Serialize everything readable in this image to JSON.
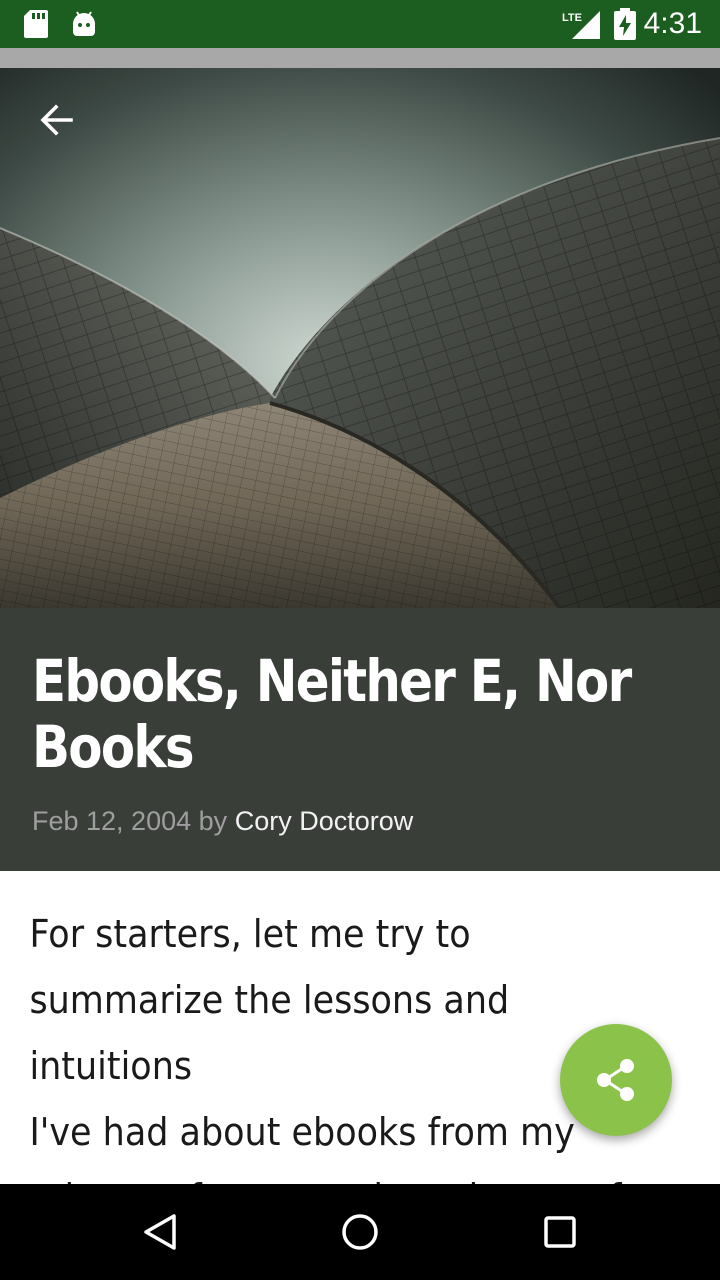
{
  "status_bar": {
    "time": "4:31",
    "network": "LTE",
    "icons": [
      "sd-card-icon",
      "android-icon",
      "lte-signal-icon",
      "battery-charging-icon"
    ]
  },
  "header": {
    "back_icon": "arrow-back-icon"
  },
  "article": {
    "title": "Ebooks, Neither E, Nor Books",
    "date": "Feb 12, 2004",
    "by": "by",
    "author": "Cory Doctorow",
    "body": "For starters, let me try to\nsummarize the lessons and\nintuitions\nI've had about ebooks from my\nrelease of two novels and most of"
  },
  "fab": {
    "icon": "share-icon",
    "color": "#8bc34a"
  },
  "nav_bar": {
    "icons": [
      "nav-back-icon",
      "nav-home-icon",
      "nav-recents-icon"
    ]
  },
  "colors": {
    "status_bar": "#1b5e20",
    "title_block": "#393e39"
  }
}
